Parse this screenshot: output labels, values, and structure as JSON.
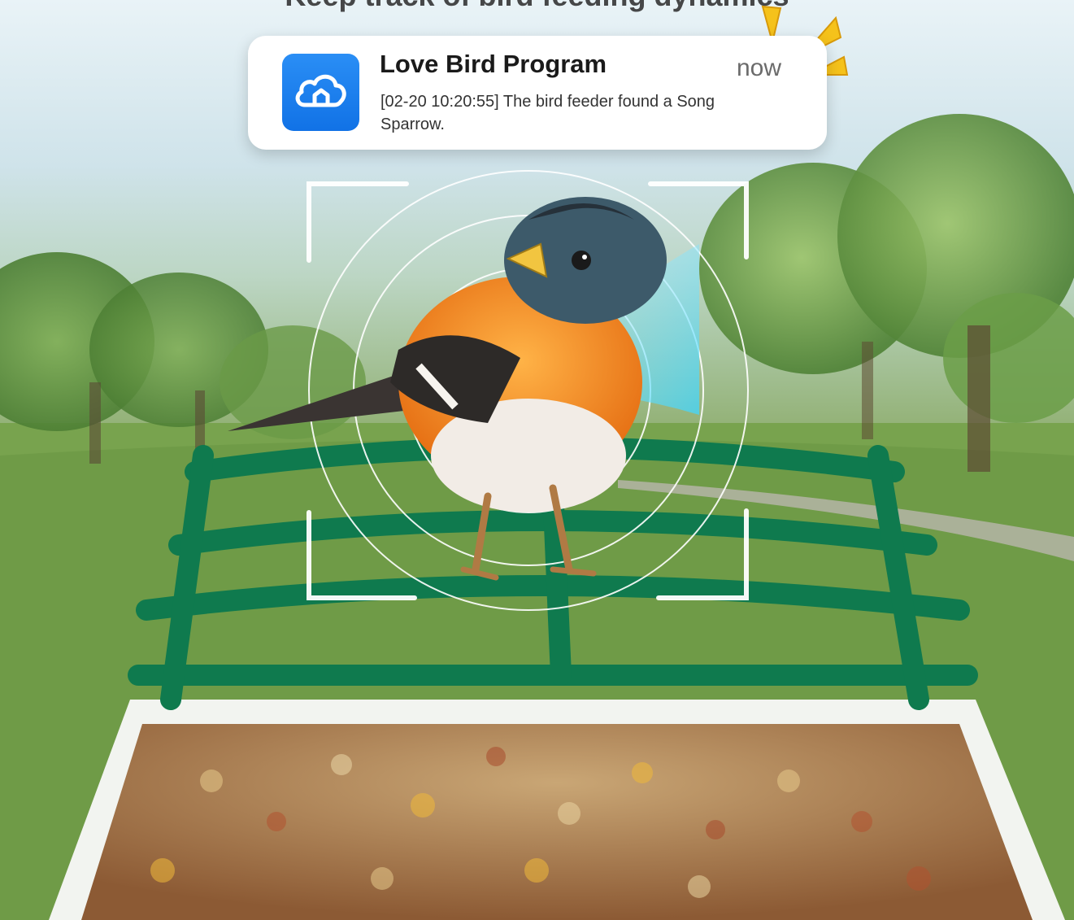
{
  "headline": "Keep track of bird feeding dynamics",
  "notification": {
    "app_icon": "cloud-home-icon",
    "title": "Love Bird Program",
    "time": "now",
    "message": "[02-20 10:20:55] The bird feeder found a Song Sparrow."
  },
  "colors": {
    "accent_blue": "#1a7ff0",
    "feeder_green": "#0f7a4e",
    "scan_cyan": "#3fd6ff",
    "spark_yellow": "#f5c21b"
  }
}
